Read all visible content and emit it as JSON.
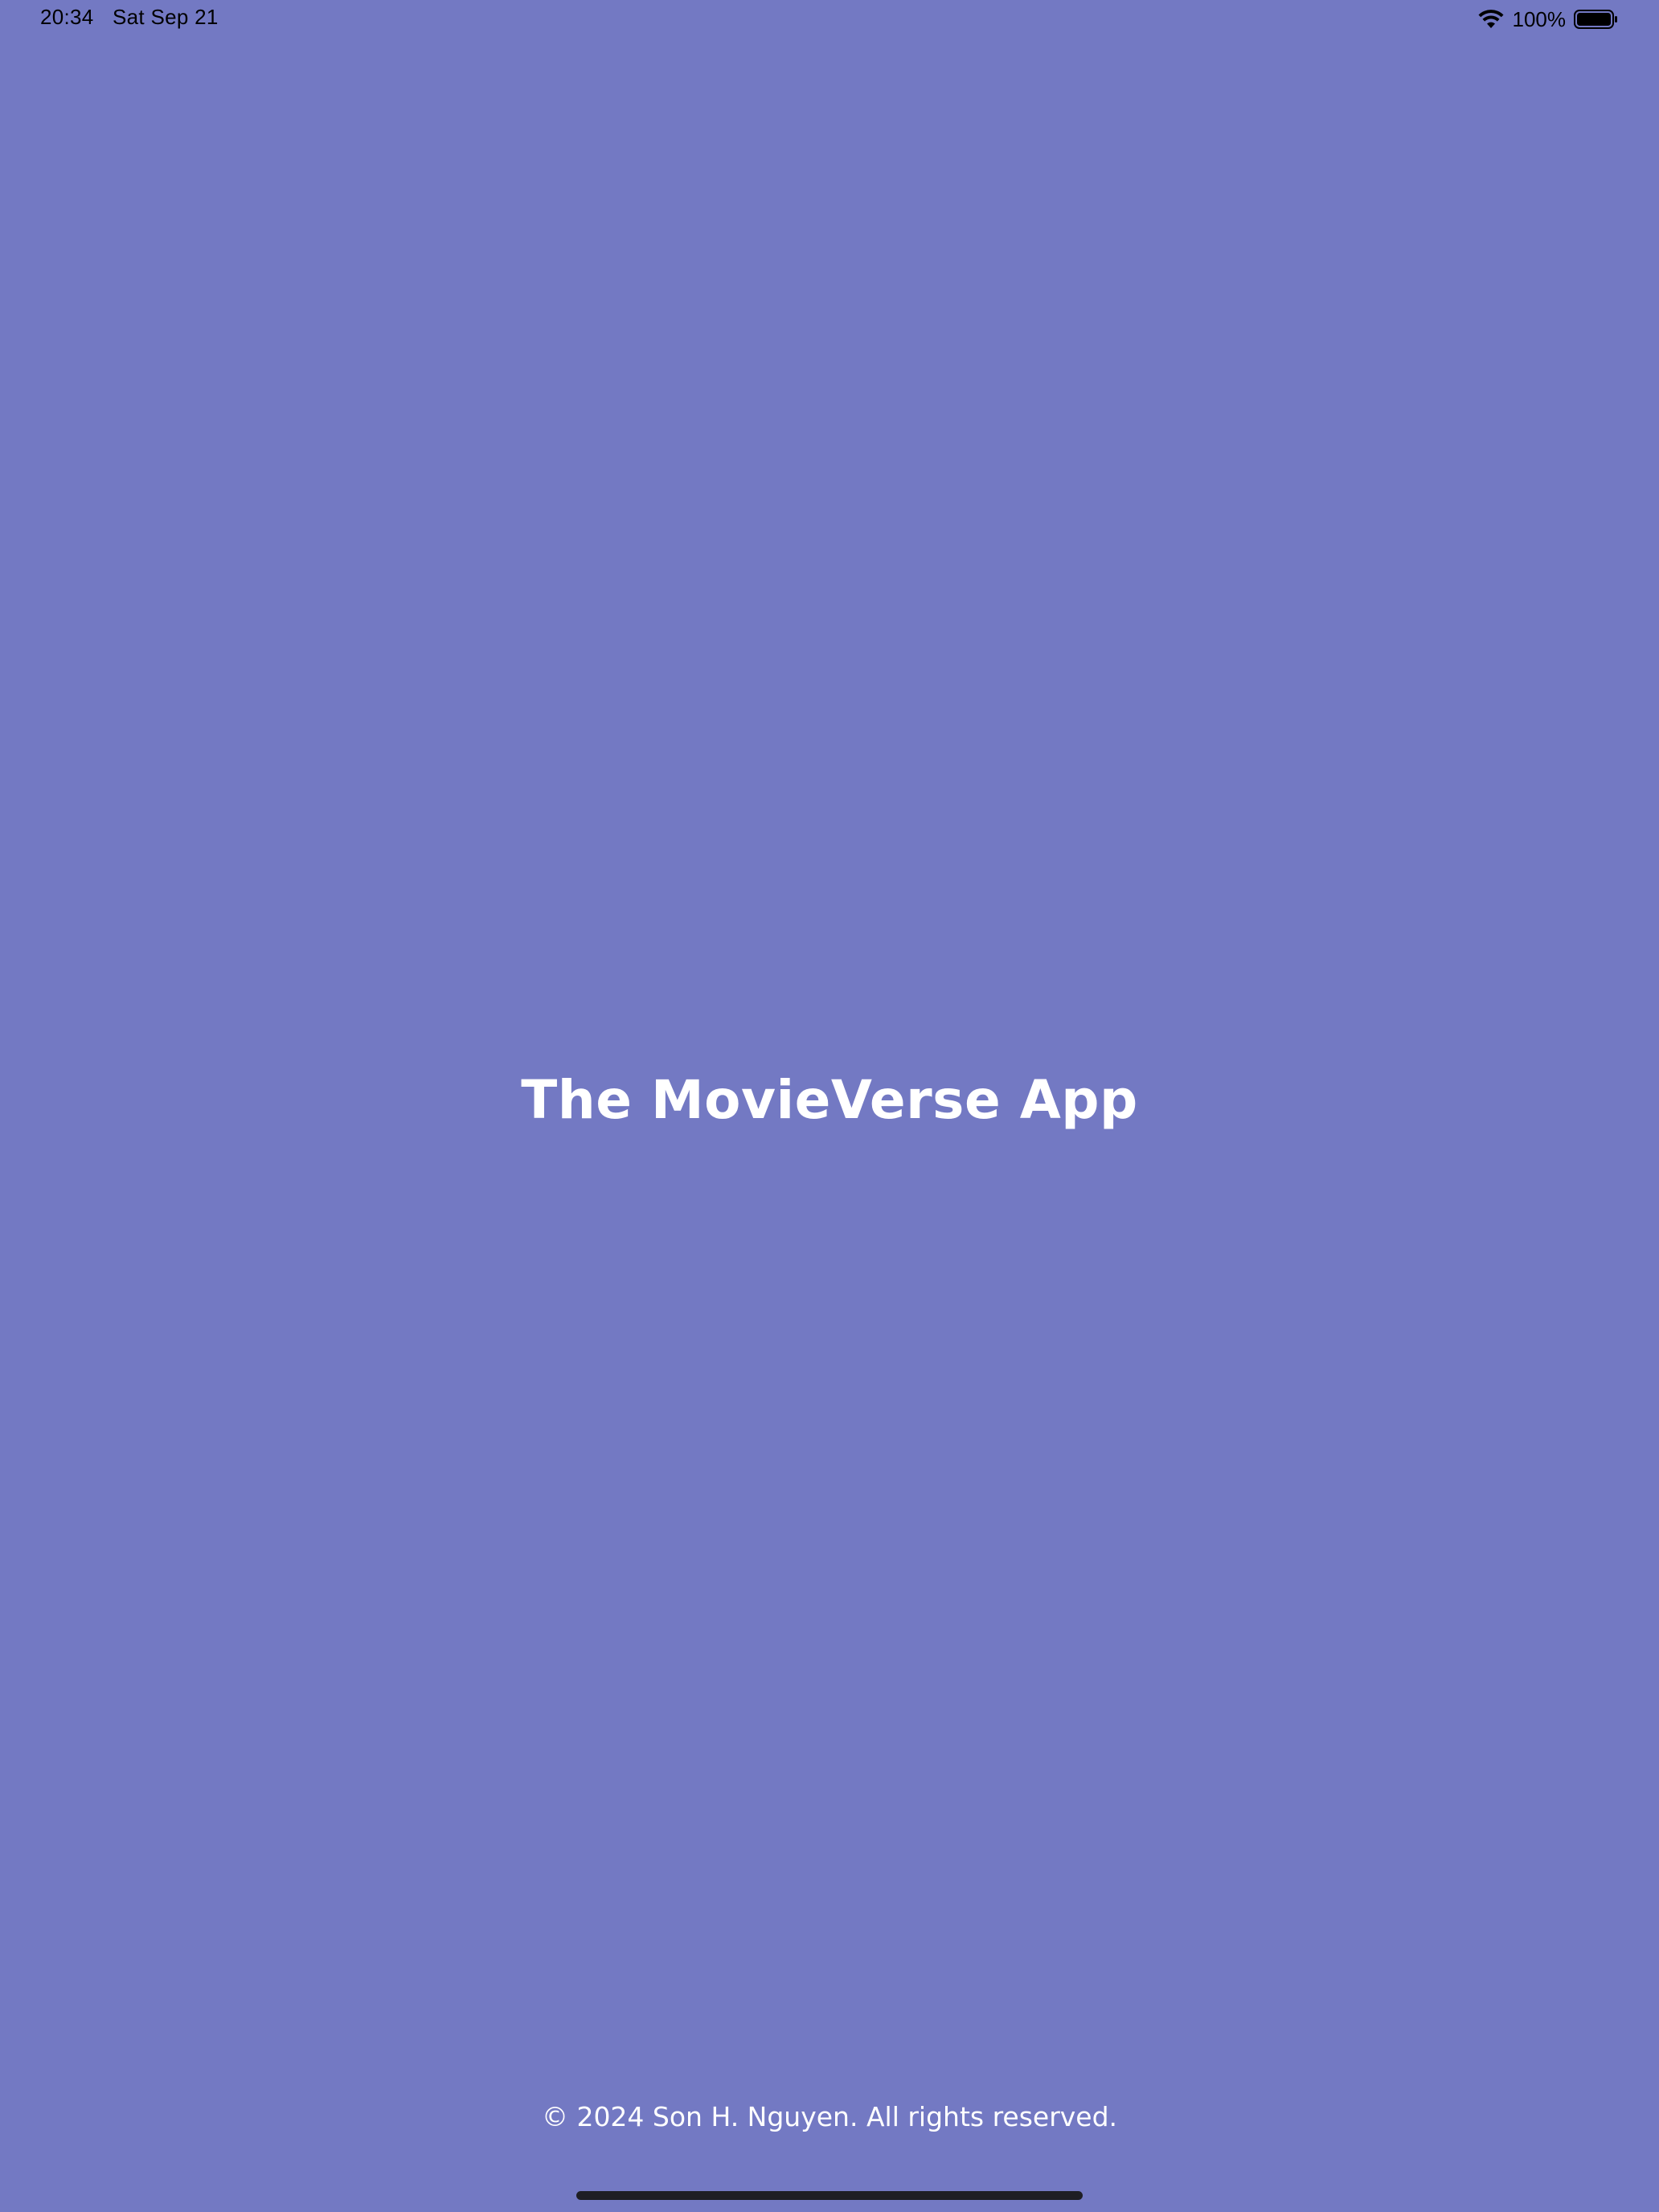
{
  "status_bar": {
    "time": "20:34",
    "date": "Sat Sep 21",
    "battery_percent": "100%",
    "battery_level": 1.0,
    "icons": [
      "wifi-icon",
      "battery-icon"
    ]
  },
  "main": {
    "title": "The MovieVerse App"
  },
  "footer": {
    "copyright": "© 2024 Son H. Nguyen. All rights reserved."
  },
  "colors": {
    "background": "#7379c3",
    "text": "#ffffff",
    "home_indicator": "#1e1e24"
  }
}
